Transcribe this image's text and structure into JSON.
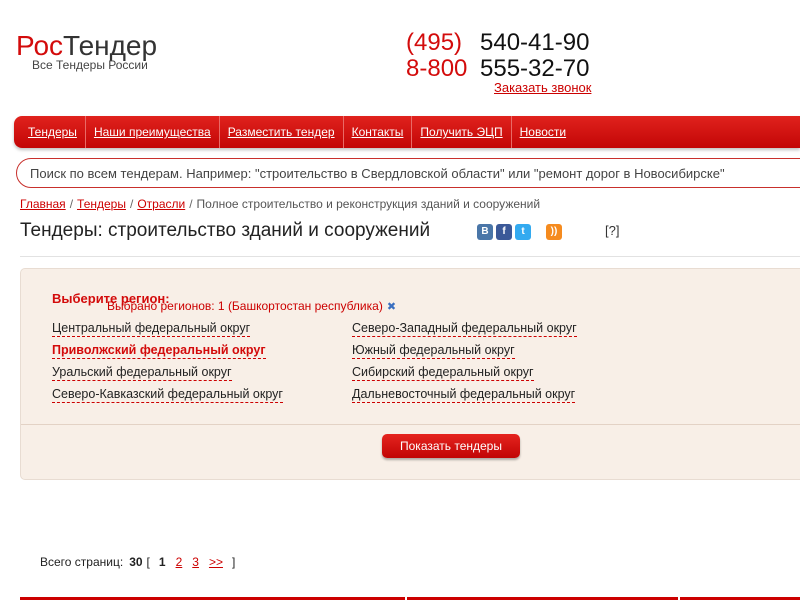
{
  "logo": {
    "part1": "Рос",
    "part2": "Тендер",
    "tagline": "Все Тендеры России"
  },
  "contacts": {
    "phone1": {
      "code": "(495)",
      "number": "540-41-90"
    },
    "phone2": {
      "code": "8-800",
      "number": "555-32-70"
    },
    "callback_label": "Заказать звонок"
  },
  "nav": {
    "items": [
      {
        "label": "Тендеры"
      },
      {
        "label": "Наши преимущества"
      },
      {
        "label": "Разместить тендер"
      },
      {
        "label": "Контакты"
      },
      {
        "label": "Получить ЭЦП"
      },
      {
        "label": "Новости"
      }
    ]
  },
  "search": {
    "placeholder": "Поиск по всем тендерам. Например: \"строительство в Свердловской области\" или \"ремонт дорог в Новосибирске\"",
    "value": ""
  },
  "breadcrumb": {
    "items": [
      "Главная",
      "Тендеры",
      "Отрасли"
    ],
    "current": "Полное строительство и реконструкция зданий и сооружений",
    "separator": "/"
  },
  "page": {
    "title": "Тендеры: строительство зданий и сооружений",
    "help_label": "[?]"
  },
  "social": {
    "vk": "B",
    "fb": "f",
    "tw": "t",
    "rss": "))"
  },
  "regions": {
    "heading": "Выберите регион:",
    "selected_text": "Выбрано регионов: 1 (Башкортостан республика)",
    "clear_icon": "✖",
    "items": [
      {
        "label": "Центральный федеральный округ"
      },
      {
        "label": "Северо-Западный федеральный округ"
      },
      {
        "label": "Приволжский федеральный округ",
        "active": true
      },
      {
        "label": "Южный федеральный округ"
      },
      {
        "label": "Уральский федеральный округ"
      },
      {
        "label": "Сибирский федеральный округ"
      },
      {
        "label": "Северо-Кавказский федеральный округ"
      },
      {
        "label": "Дальневосточный федеральный округ"
      }
    ],
    "button_label": "Показать тендеры"
  },
  "pagination": {
    "label": "Всего страниц:",
    "total": "30",
    "open": "[",
    "current": "1",
    "pages": [
      "2",
      "3"
    ],
    "next": ">>",
    "close": "]"
  },
  "colors": {
    "brand": "#d30b0b",
    "link": "#cc0000",
    "panel_bg": "#f8efe7"
  }
}
